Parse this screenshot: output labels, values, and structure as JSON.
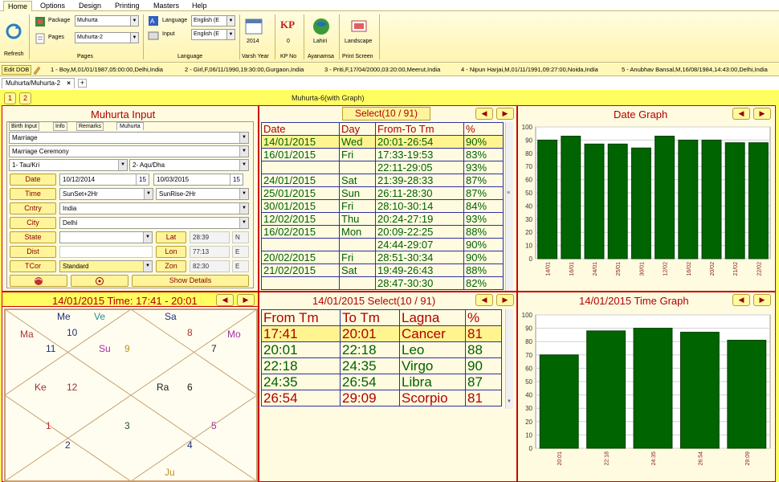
{
  "menu": {
    "tabs": [
      "Home",
      "Options",
      "Design",
      "Printing",
      "Masters",
      "Help"
    ]
  },
  "ribbon": {
    "refresh": "Refresh",
    "package_label": "Package",
    "package_value": "Muhurta",
    "pages_label": "Pages",
    "pages_value": "Muhurta-2",
    "pages_group": "Pages",
    "language_label": "Language",
    "language_value": "English (E",
    "input_label": "Input",
    "input_value": "English (E",
    "language_group": "Language",
    "varsh_value": "2014",
    "varsh_group": "Varsh Year",
    "kp_value": "0",
    "kp_group": "KP No",
    "ayan_value": "Lahiri",
    "ayan_group": "Ayanamsa",
    "print_label": "Landscape",
    "print_group": "Print Screen",
    "kp_icon": "KP"
  },
  "dob": {
    "edit": "Edit DOB",
    "entries": [
      "1 - Boy,M,01/01/1987,05:00:00,Delhi,India",
      "2 - Girl,F,06/11/1990,19:30:00,Gurgaon,India",
      "3 - Priti,F,17/04/2000,03:20:00,Meerut,India",
      "4 - Nipun Harjai,M,01/11/1991,09:27:00,Noida,India",
      "5 - Anubhav Bansal,M,16/08/1984,14:43:00,Delhi,India"
    ]
  },
  "doc": {
    "tab": "Muhurta/Muhurta-2",
    "close": "×",
    "add": "+",
    "page1": "1",
    "page2": "2",
    "title": "Muhurta-6(with Graph)"
  },
  "input": {
    "title": "Muhurta Input",
    "subtabs": [
      "Birth Input",
      "Info",
      "Remarks",
      "Muhurta"
    ],
    "event": "Marriage",
    "event_type": "Marriage Ceremony",
    "nak1": "1- Tau/Kri",
    "nak2": "2- Aqu/Dha",
    "date_label": "Date",
    "date1": "10/12/2014",
    "date2": "10/03/2015",
    "cal": "15",
    "time_label": "Time",
    "time1": "SunSet+2Hr",
    "time2": "SunRise-2Hr",
    "cntry_label": "Cntry",
    "cntry": "India",
    "city_label": "City",
    "city": "Delhi",
    "state_label": "State",
    "lat_label": "Lat",
    "lat": "28:39",
    "lat_dir": "N",
    "dist_label": "Dist",
    "lon_label": "Lon",
    "lon": "77:13",
    "lon_dir": "E",
    "tcor_label": "TCor",
    "tcor": "Standard",
    "zon_label": "Zon",
    "zon": "82:30",
    "zon_dir": "E",
    "show_details": "Show Details"
  },
  "select": {
    "title": "Select(10 / 91)",
    "headers": [
      "Date",
      "Day",
      "From-To Tm",
      "%"
    ],
    "rows": [
      [
        "14/01/2015",
        "Wed",
        "20:01-26:54",
        "90%"
      ],
      [
        "16/01/2015",
        "Fri",
        "17:33-19:53",
        "83%"
      ],
      [
        "",
        "",
        "22:11-29:05",
        "93%"
      ],
      [
        "24/01/2015",
        "Sat",
        "21:39-28:33",
        "87%"
      ],
      [
        "25/01/2015",
        "Sun",
        "26:11-28:30",
        "87%"
      ],
      [
        "30/01/2015",
        "Fri",
        "28:10-30:14",
        "84%"
      ],
      [
        "12/02/2015",
        "Thu",
        "20:24-27:19",
        "93%"
      ],
      [
        "16/02/2015",
        "Mon",
        "20:09-22:25",
        "88%"
      ],
      [
        "",
        "",
        "24:44-29:07",
        "90%"
      ],
      [
        "20/02/2015",
        "Fri",
        "28:51-30:34",
        "90%"
      ],
      [
        "21/02/2015",
        "Sat",
        "19:49-26:43",
        "88%"
      ],
      [
        "",
        "",
        "28:47-30:30",
        "82%"
      ]
    ]
  },
  "date_graph": {
    "title": "Date Graph"
  },
  "kundli": {
    "title": "14/01/2015 Time: 17:41 - 20:01",
    "planets": {
      "me": "Me",
      "ve": "Ve",
      "sa": "Sa",
      "ma": "Ma",
      "mo": "Mo",
      "su": "Su",
      "ke": "Ke",
      "ra": "Ra",
      "ju": "Ju"
    },
    "houses": [
      "10",
      "8",
      "11",
      "9",
      "7",
      "12",
      "6",
      "1",
      "3",
      "5",
      "2",
      "4"
    ]
  },
  "lagna": {
    "title": "14/01/2015 Select(10 / 91)",
    "headers": [
      "From Tm",
      "To Tm",
      "Lagna",
      "%"
    ],
    "rows": [
      [
        "17:41",
        "20:01",
        "Cancer",
        "81"
      ],
      [
        "20:01",
        "22:18",
        "Leo",
        "88"
      ],
      [
        "22:18",
        "24:35",
        "Virgo",
        "90"
      ],
      [
        "24:35",
        "26:54",
        "Libra",
        "87"
      ],
      [
        "26:54",
        "29:09",
        "Scorpio",
        "81"
      ]
    ]
  },
  "time_graph": {
    "title": "14/01/2015 Time Graph"
  },
  "colors": {
    "accent_red": "#b00000",
    "bar_green": "#006400",
    "frame_yellow": "#fffe60"
  },
  "chart_data": [
    {
      "type": "bar",
      "title": "Date Graph",
      "categories": [
        "14/01",
        "16/01",
        "24/01",
        "25/01",
        "30/01",
        "12/02",
        "16/02",
        "20/02",
        "21/02",
        "22/02"
      ],
      "values": [
        90,
        93,
        87,
        87,
        84,
        93,
        90,
        90,
        88,
        88
      ],
      "yticks": [
        "0",
        "10",
        "20",
        "30",
        "40",
        "50",
        "60",
        "70",
        "80",
        "90",
        "100"
      ],
      "ylim": [
        0,
        100
      ],
      "grid": true
    },
    {
      "type": "bar",
      "title": "14/01/2015 Time Graph",
      "categories": [
        "20:01",
        "22:18",
        "24:35",
        "26:54",
        "29:09"
      ],
      "values": [
        70,
        88,
        90,
        87,
        81
      ],
      "yticks": [
        "0",
        "10",
        "20",
        "30",
        "40",
        "50",
        "60",
        "70",
        "80",
        "90",
        "100"
      ],
      "ylim": [
        0,
        100
      ],
      "grid": true
    }
  ]
}
